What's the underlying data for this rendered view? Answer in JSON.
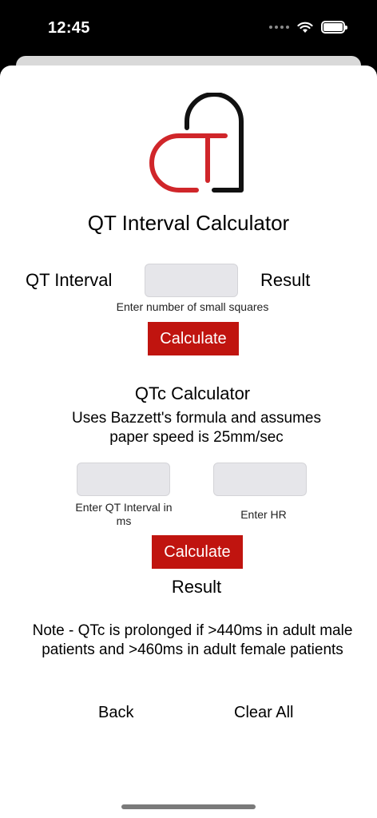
{
  "status_bar": {
    "time": "12:45",
    "icons": [
      "signal-dots-icon",
      "wifi-icon",
      "battery-icon"
    ]
  },
  "app": {
    "title": "QT Interval Calculator",
    "colors": {
      "accent_red": "#c0140f",
      "logo_red": "#d0262a",
      "logo_black": "#111111",
      "input_bg": "#e6e6ea"
    }
  },
  "qt_calculator": {
    "label": "QT Interval",
    "input_value": "",
    "result_label": "Result",
    "hint": "Enter number of small squares",
    "button_label": "Calculate"
  },
  "qtc_calculator": {
    "title": "QTc Calculator",
    "description": "Uses Bazzett's formula and assumes paper speed is 25mm/sec",
    "qt_input_value": "",
    "qt_hint": "Enter QT Interval in ms",
    "hr_input_value": "",
    "hr_hint": "Enter HR",
    "button_label": "Calculate",
    "result_label": "Result"
  },
  "note": "Note - QTc is prolonged if >440ms in adult male patients and >460ms in adult female patients",
  "footer": {
    "back_label": "Back",
    "clear_label": "Clear All"
  }
}
